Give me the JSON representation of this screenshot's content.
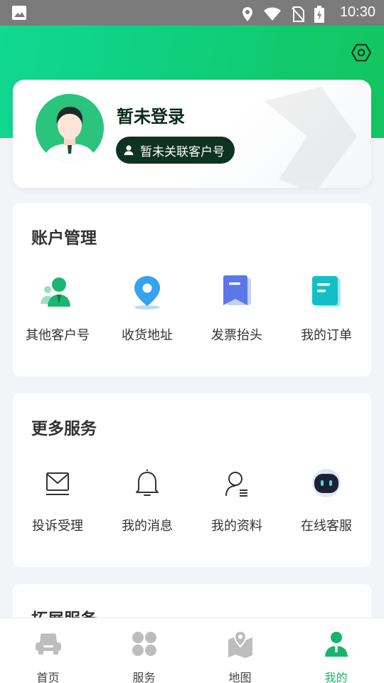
{
  "status_bar": {
    "time": "10:30"
  },
  "profile": {
    "name": "暂未登录",
    "badge": "暂未关联客户号"
  },
  "account_section": {
    "title": "账户管理",
    "items": [
      {
        "label": "其他客户号",
        "icon": "user-switch-icon"
      },
      {
        "label": "收货地址",
        "icon": "location-pin-icon"
      },
      {
        "label": "发票抬头",
        "icon": "bookmark-icon"
      },
      {
        "label": "我的订单",
        "icon": "order-list-icon"
      }
    ]
  },
  "more_section": {
    "title": "更多服务",
    "items": [
      {
        "label": "投诉受理",
        "icon": "mail-icon"
      },
      {
        "label": "我的消息",
        "icon": "bell-icon"
      },
      {
        "label": "我的资料",
        "icon": "profile-icon"
      },
      {
        "label": "在线客服",
        "icon": "robot-icon"
      }
    ]
  },
  "ext_section": {
    "title": "拓展服务"
  },
  "tabs": [
    {
      "label": "首页",
      "icon": "car-icon"
    },
    {
      "label": "服务",
      "icon": "grid-icon"
    },
    {
      "label": "地图",
      "icon": "map-icon"
    },
    {
      "label": "我的",
      "icon": "user-icon",
      "active": true
    }
  ],
  "colors": {
    "brand": "#17b56c",
    "badge": "#0e3323",
    "active_tab": "#17b56c"
  }
}
